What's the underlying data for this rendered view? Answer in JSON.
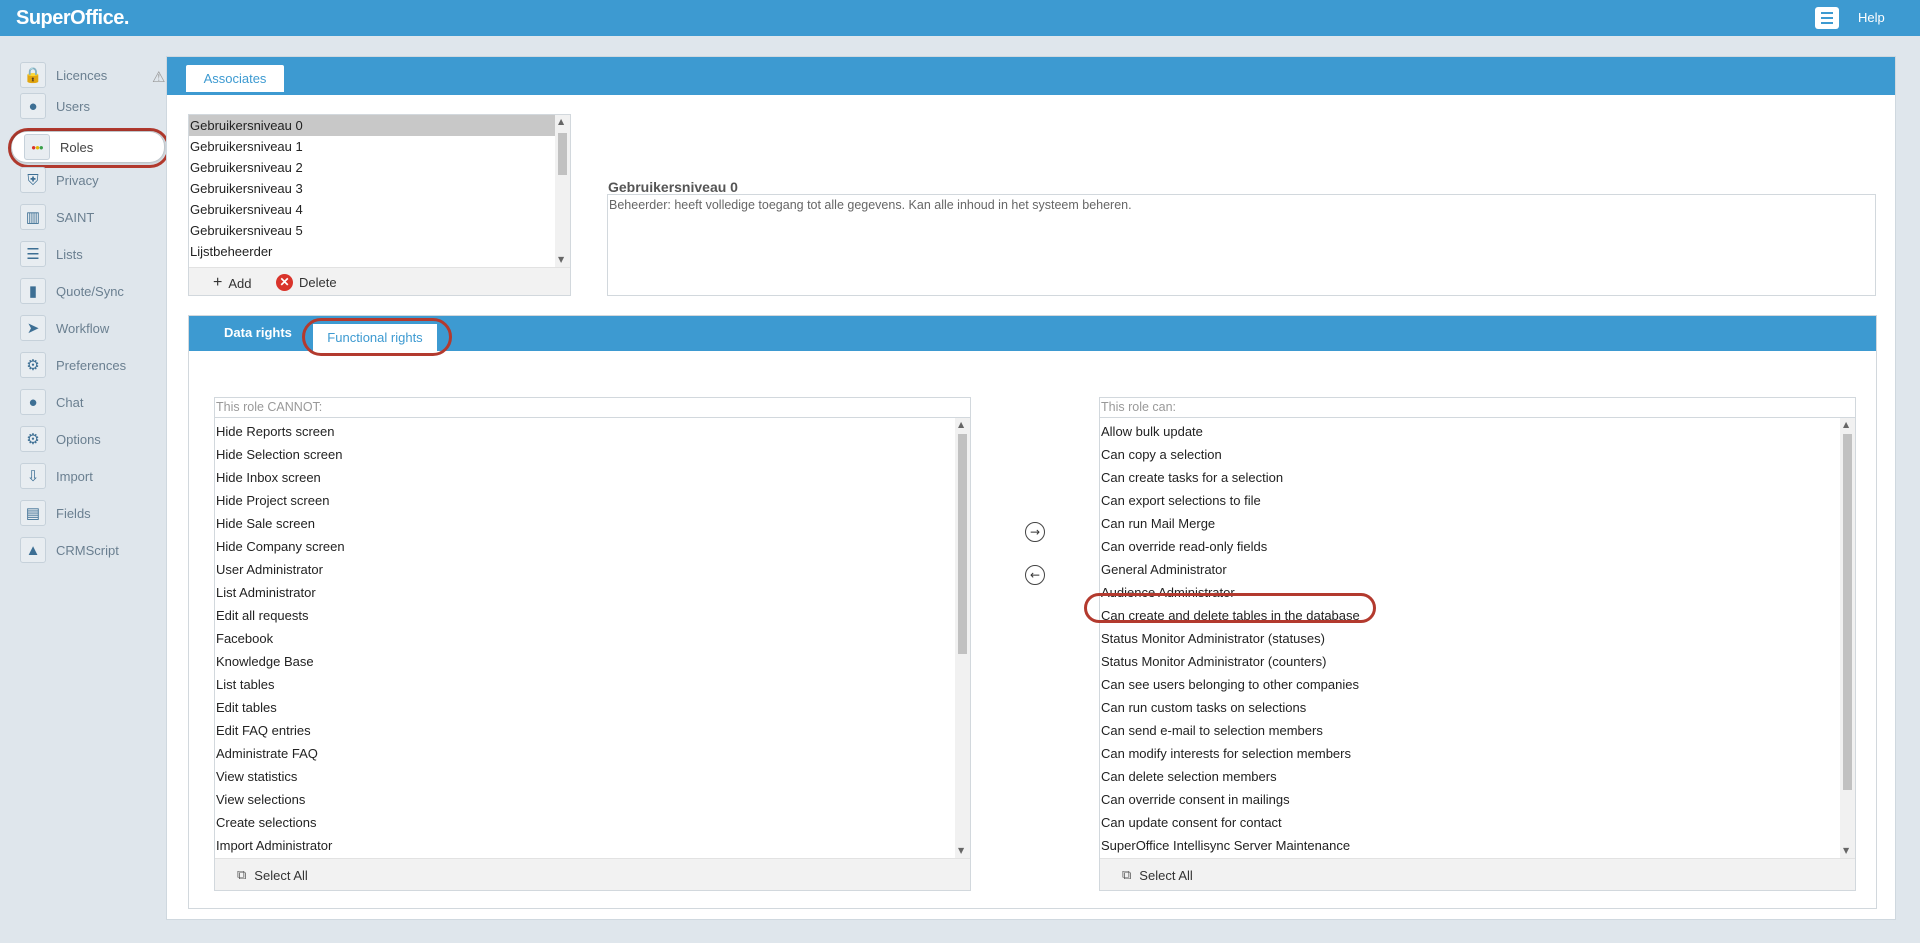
{
  "app": {
    "logo": "SuperOffice.",
    "help": "Help"
  },
  "sidebar": {
    "items": [
      {
        "label": "Licences",
        "icon": "lock-icon"
      },
      {
        "label": "Users",
        "icon": "user-icon"
      },
      {
        "label": "Roles",
        "icon": "traffic-light-icon"
      },
      {
        "label": "Privacy",
        "icon": "shield-icon"
      },
      {
        "label": "SAINT",
        "icon": "bar-chart-icon"
      },
      {
        "label": "Lists",
        "icon": "list-icon"
      },
      {
        "label": "Quote/Sync",
        "icon": "barcode-icon"
      },
      {
        "label": "Workflow",
        "icon": "signpost-icon"
      },
      {
        "label": "Preferences",
        "icon": "gear-icon"
      },
      {
        "label": "Chat",
        "icon": "chat-bubble-icon"
      },
      {
        "label": "Options",
        "icon": "cog-icon"
      },
      {
        "label": "Import",
        "icon": "import-icon"
      },
      {
        "label": "Fields",
        "icon": "fields-icon"
      },
      {
        "label": "CRMScript",
        "icon": "rocket-icon"
      }
    ],
    "active": "Roles"
  },
  "main": {
    "tab": "Associates",
    "roles": [
      "Gebruikersniveau 0",
      "Gebruikersniveau 1",
      "Gebruikersniveau 2",
      "Gebruikersniveau 3",
      "Gebruikersniveau 4",
      "Gebruikersniveau 5",
      "Lijstbeheerder"
    ],
    "selected_role": "Gebruikersniveau 0",
    "add_label": "Add",
    "delete_label": "Delete",
    "description_title": "Gebruikersniveau 0",
    "description": "Beheerder: heeft volledige toegang tot alle gegevens. Kan alle inhoud in het systeem beheren."
  },
  "rights": {
    "tabs": {
      "data": "Data rights",
      "functional": "Functional rights"
    },
    "active_tab": "Functional rights",
    "cannot": {
      "caption": "This role CANNOT:",
      "items": [
        "Hide Reports screen",
        "Hide Selection screen",
        "Hide Inbox screen",
        "Hide Project screen",
        "Hide Sale screen",
        "Hide Company screen",
        "User Administrator",
        "List Administrator",
        "Edit all requests",
        "Facebook",
        "Knowledge Base",
        "List tables",
        "Edit tables",
        "Edit FAQ entries",
        "Administrate FAQ",
        "View statistics",
        "View selections",
        "Create selections",
        "Import Administrator"
      ],
      "select_all": "Select All"
    },
    "can": {
      "caption": "This role can:",
      "items": [
        "Allow bulk update",
        "Can copy a selection",
        "Can create tasks for a selection",
        "Can export selections to file",
        "Can run Mail Merge",
        "Can override read-only fields",
        "General Administrator",
        "Audience Administrator",
        "Can create and delete tables in the database",
        "Status Monitor Administrator (statuses)",
        "Status Monitor Administrator (counters)",
        "Can see users belonging to other companies",
        "Can run custom tasks on selections",
        "Can send e-mail to selection members",
        "Can modify interests for selection members",
        "Can delete selection members",
        "Can override consent in mailings",
        "Can update consent for contact",
        "SuperOffice Intellisync Server Maintenance"
      ],
      "select_all": "Select All"
    }
  }
}
